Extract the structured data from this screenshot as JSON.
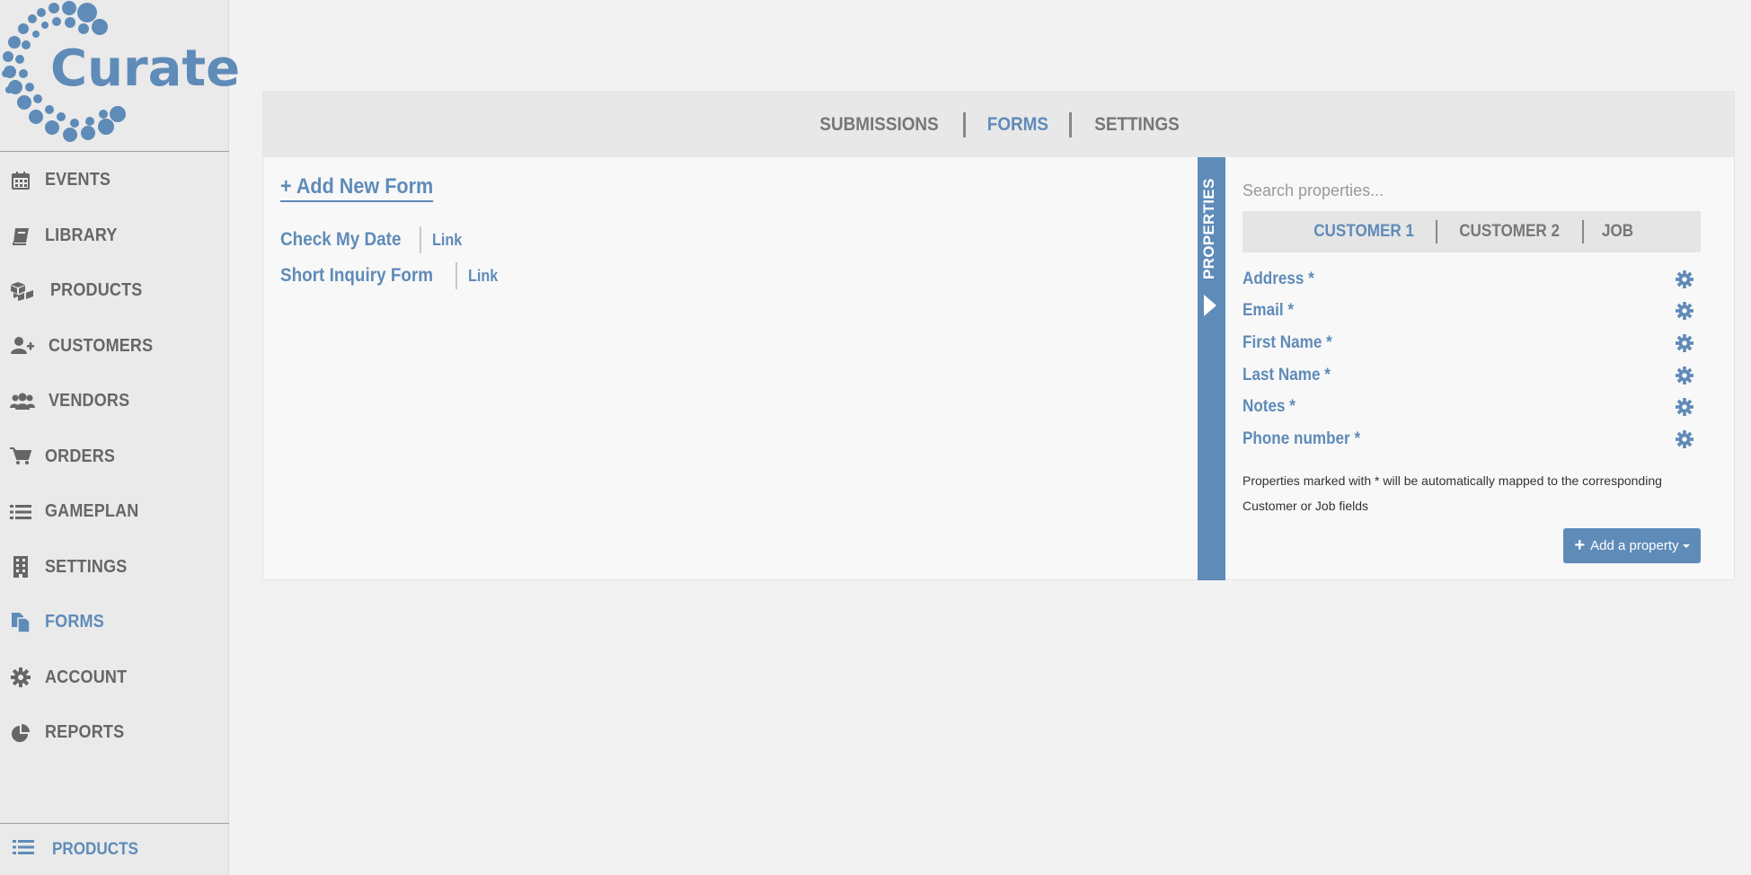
{
  "brand": {
    "name": "Curate",
    "accent": "#5f8bb8"
  },
  "sidebar": {
    "items": [
      {
        "label": "EVENTS",
        "icon": "calendar-icon"
      },
      {
        "label": "LIBRARY",
        "icon": "book-icon"
      },
      {
        "label": "PRODUCTS",
        "icon": "cubes-icon"
      },
      {
        "label": "CUSTOMERS",
        "icon": "user-plus-icon"
      },
      {
        "label": "VENDORS",
        "icon": "users-icon"
      },
      {
        "label": "ORDERS",
        "icon": "cart-icon"
      },
      {
        "label": "GAMEPLAN",
        "icon": "list-icon"
      },
      {
        "label": "SETTINGS",
        "icon": "building-icon"
      },
      {
        "label": "FORMS",
        "icon": "files-icon",
        "active": true
      },
      {
        "label": "ACCOUNT",
        "icon": "gear-icon"
      },
      {
        "label": "REPORTS",
        "icon": "pie-chart-icon"
      }
    ],
    "bottom": {
      "label": "PRODUCTS",
      "icon": "list-icon"
    }
  },
  "tabs": [
    {
      "label": "SUBMISSIONS"
    },
    {
      "label": "FORMS",
      "active": true
    },
    {
      "label": "SETTINGS"
    }
  ],
  "forms": {
    "add_label": "+ Add New Form",
    "items": [
      {
        "name": "Check My Date",
        "link": "Link"
      },
      {
        "name": "Short Inquiry Form",
        "link": "Link"
      }
    ]
  },
  "properties": {
    "strip_label": "PROPERTIES",
    "search_placeholder": "Search properties...",
    "tabs": [
      {
        "label": "CUSTOMER 1",
        "active": true
      },
      {
        "label": "CUSTOMER 2"
      },
      {
        "label": "JOB"
      }
    ],
    "items": [
      {
        "name": "Address *"
      },
      {
        "name": "Email *"
      },
      {
        "name": "First Name *"
      },
      {
        "name": "Last Name *"
      },
      {
        "name": "Notes *"
      },
      {
        "name": "Phone number *"
      }
    ],
    "note": "Properties marked with * will be automatically mapped to the corresponding Customer or Job fields",
    "add_button": "Add a property"
  }
}
